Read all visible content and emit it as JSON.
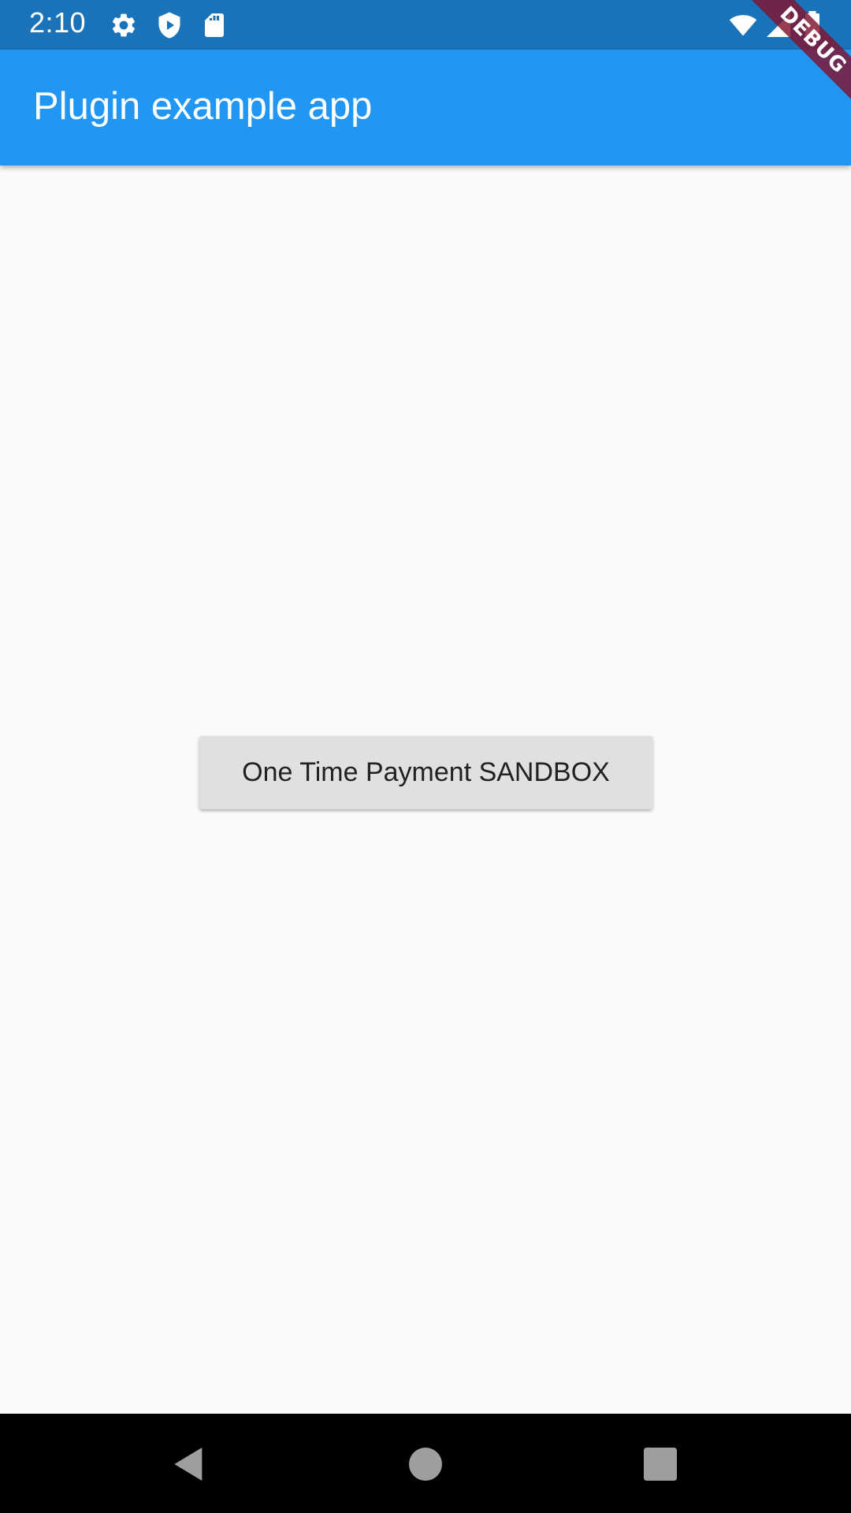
{
  "status_bar": {
    "time": "2:10",
    "background": "#1a72b9",
    "left_icons": [
      "settings-icon",
      "shield-play-icon",
      "sd-card-icon"
    ],
    "right_icons": [
      "wifi-icon",
      "cellular-signal-icon",
      "battery-icon"
    ]
  },
  "app_bar": {
    "title": "Plugin example app",
    "background": "#2196f3"
  },
  "debug_banner": {
    "label": "DEBUG",
    "color": "#801430"
  },
  "main": {
    "background": "#fafafa",
    "payment_button_label": "One Time Payment SANDBOX"
  },
  "nav_bar": {
    "buttons": [
      "back-icon",
      "home-icon",
      "recents-icon"
    ]
  }
}
